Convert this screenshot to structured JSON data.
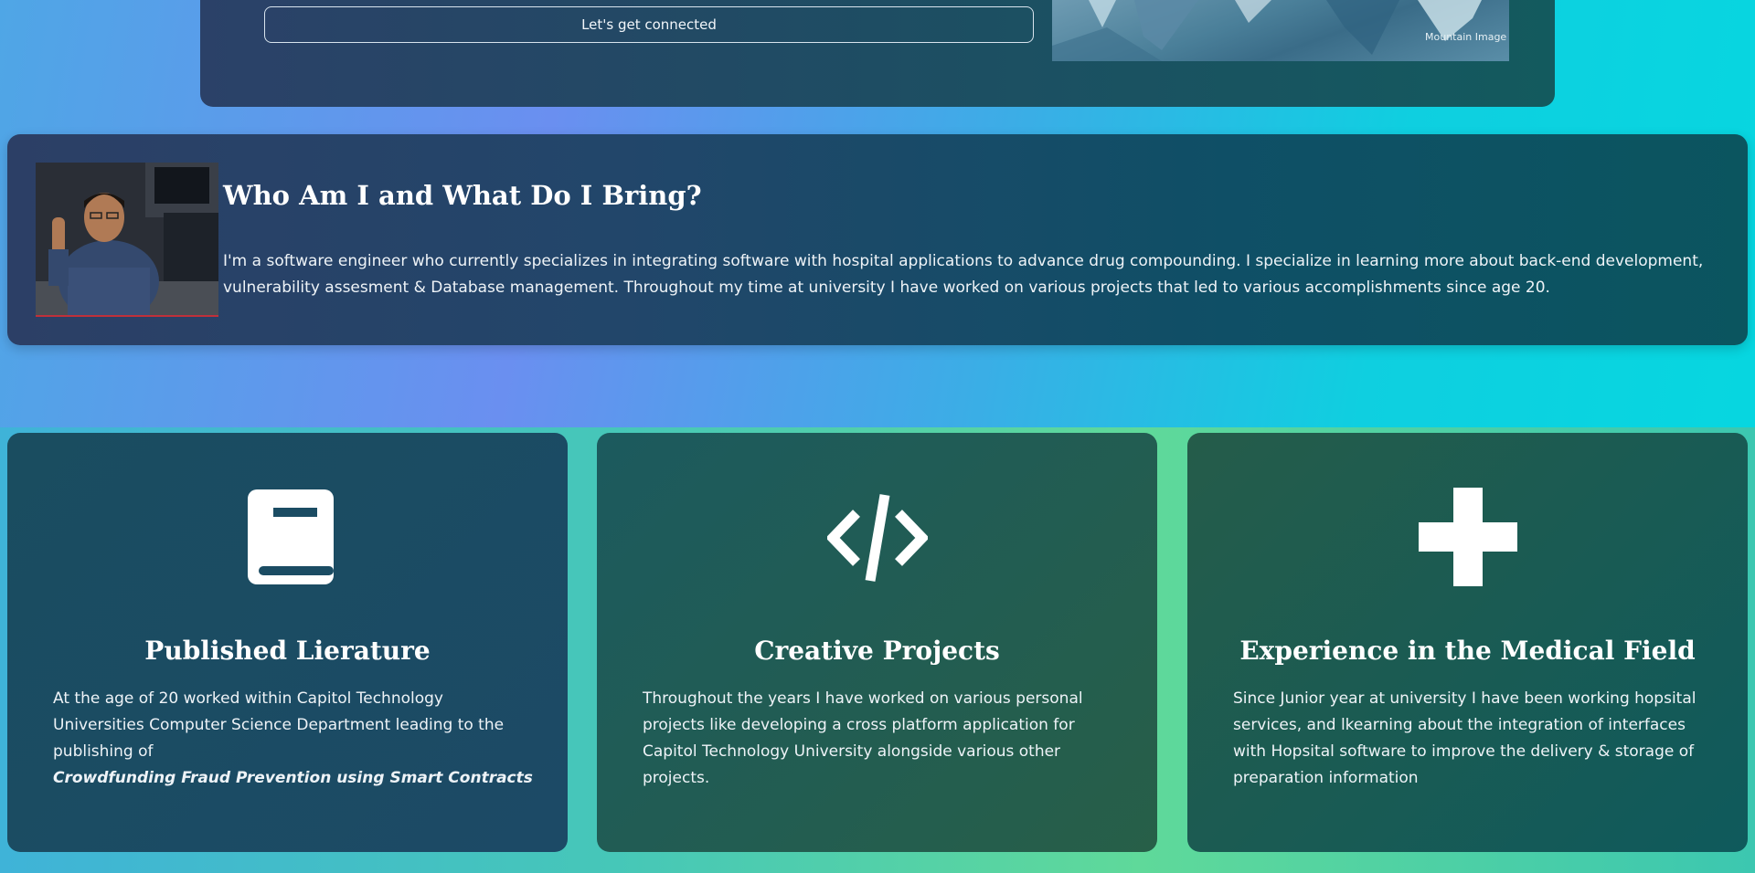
{
  "hero": {
    "connect_label": "Let's get connected",
    "image_caption": "Mountain Image"
  },
  "about": {
    "title": "Who Am I and What Do I Bring?",
    "text": "I'm a software engineer who currently specializes in integrating software with hospital applications to advance drug compounding. I specialize in learning more about back-end development, vulnerability assesment & Database management. Throughout my time at university I have worked on various projects that led to various accomplishments since age 20."
  },
  "features": [
    {
      "icon": "book-icon",
      "title": "Published Lierature",
      "text": "At the age of 20 worked within Capitol Technology Universities Computer Science Department leading to the publishing of",
      "emphasis": "Crowdfunding Fraud Prevention using Smart Contracts"
    },
    {
      "icon": "code-icon",
      "title": "Creative Projects",
      "text": "Throughout the years I have worked on various personal projects like developing a cross platform application for Capitol Technology University alongside various other projects."
    },
    {
      "icon": "plus-icon",
      "title": "Experience in the Medical Field",
      "text": "Since Junior year at university I have been working hopsital services, and lkearning about the integration of interfaces with Hopsital software to improve the delivery & storage of preparation information"
    }
  ]
}
